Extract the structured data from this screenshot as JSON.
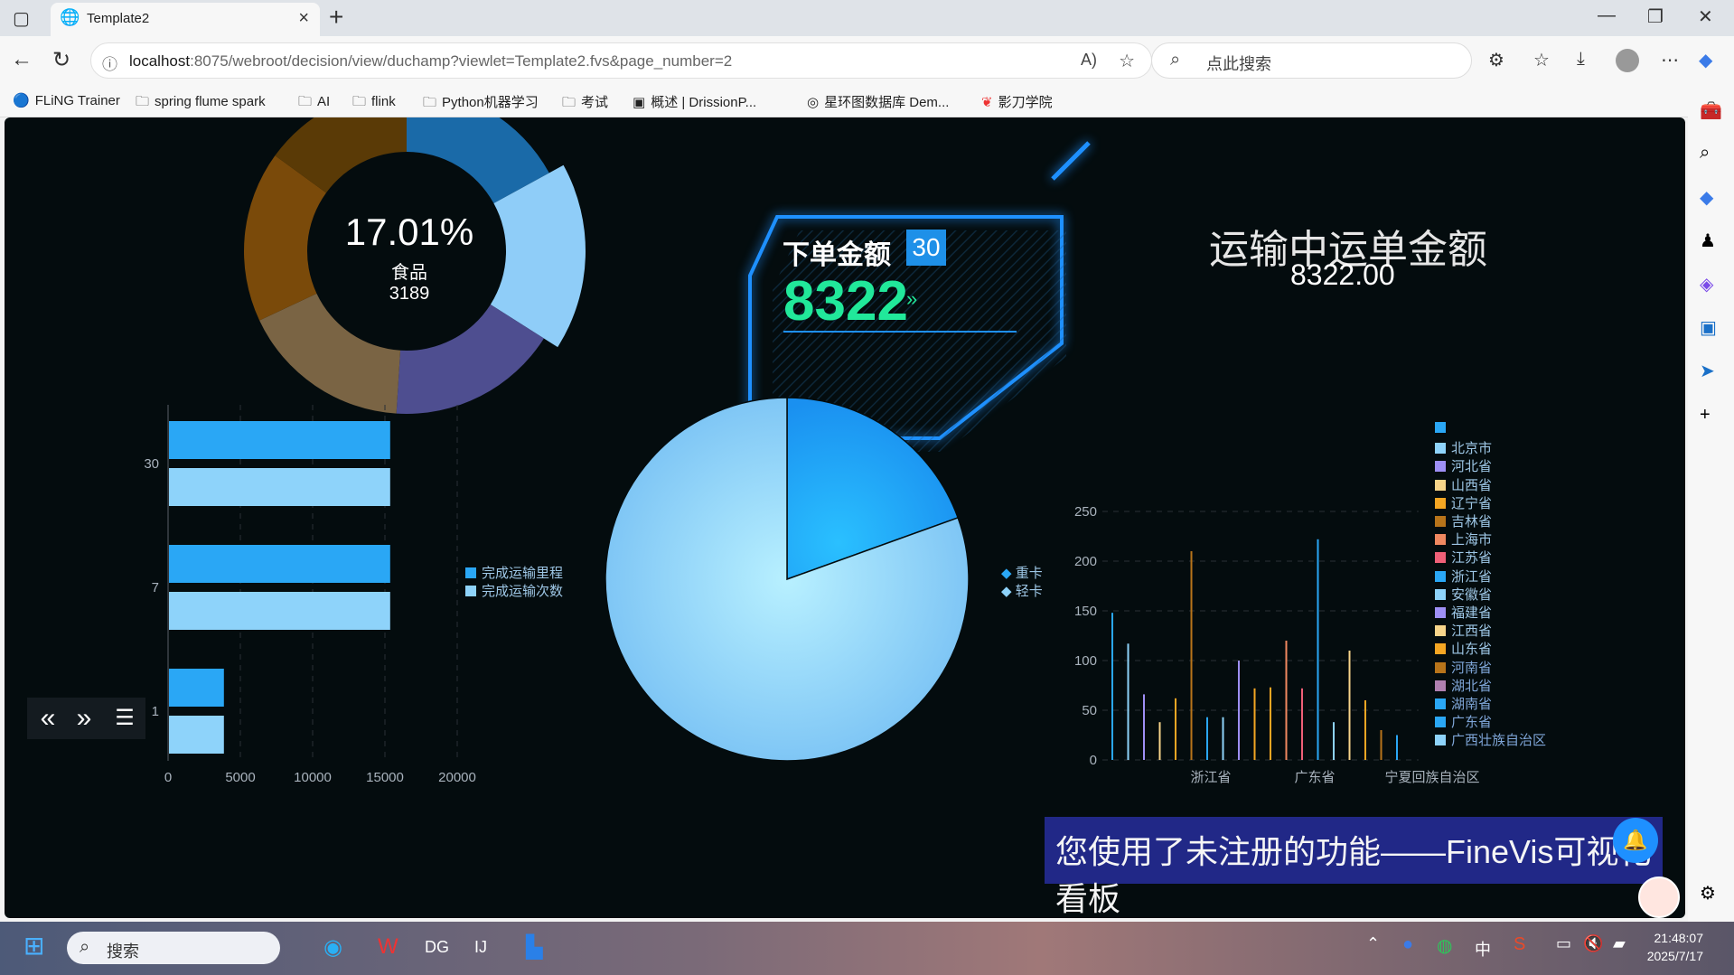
{
  "browser": {
    "tab_title": "Template2",
    "url_host": "localhost",
    "url_rest": ":8075/webroot/decision/view/duchamp?viewlet=Template2.fvs&page_number=2",
    "search_placeholder": "点此搜索",
    "bookmarks": [
      "FLiNG Trainer",
      "spring  flume  spark",
      "AI",
      "flink",
      "Python机器学习",
      "考试",
      "概述 | DrissionP...",
      "星环图数据库 Dem...",
      "影刀学院"
    ]
  },
  "donut": {
    "percent": "17.01%",
    "name": "食品",
    "value": "3189"
  },
  "order": {
    "title": "下单金额",
    "badge": "30",
    "value": "8322",
    "arrow": "»"
  },
  "transport": {
    "title": "运输中运单金额",
    "value": "8322.00"
  },
  "chart_data": [
    {
      "type": "pie",
      "title": "",
      "labels": [
        "",
        "",
        "",
        "",
        "",
        ""
      ],
      "values": [
        17.01,
        17.0,
        17.0,
        17.0,
        17.0,
        15.0
      ],
      "colors": [
        "#1a6aa8",
        "#8fcdf8",
        "#4e4e90",
        "#7a6444",
        "#7a4a0a",
        "#5a3a06"
      ]
    },
    {
      "type": "bar",
      "orientation": "horizontal",
      "categories": [
        "30",
        "7",
        "1"
      ],
      "series": [
        {
          "name": "完成运输里程",
          "values": [
            15300,
            15300,
            3800
          ],
          "color": "#2aa7f5"
        },
        {
          "name": "完成运输次数",
          "values": [
            15300,
            15300,
            3800
          ],
          "color": "#8ed3fa"
        }
      ],
      "xlim": [
        0,
        20000
      ],
      "xticks": [
        "0",
        "5000",
        "10000",
        "15000",
        "20000"
      ]
    },
    {
      "type": "pie",
      "labels": [
        "重卡",
        "轻卡"
      ],
      "values": [
        19.5,
        80.5
      ],
      "colors": [
        "#2aa7f5",
        "#8ed3fa"
      ]
    },
    {
      "type": "bar",
      "categories": [
        "浙江省",
        "广东省",
        "宁夏回族自治区"
      ],
      "ylim": [
        0,
        250
      ],
      "yticks": [
        "0",
        "50",
        "100",
        "150",
        "200",
        "250"
      ],
      "legend": [
        "",
        "北京市",
        "河北省",
        "山西省",
        "辽宁省",
        "吉林省",
        "上海市",
        "江苏省",
        "浙江省",
        "安徽省",
        "福建省",
        "江西省",
        "山东省",
        "河南省",
        "湖北省",
        "湖南省",
        "广东省",
        "广西壮族自治区"
      ],
      "legend_colors": [
        "#2aa7f5",
        "#8ed3fa",
        "#9e8ff5",
        "#f8d58a",
        "#f5a623",
        "#b8741a",
        "#f08860",
        "#f06078",
        "#2aa7f5",
        "#8ed3fa",
        "#9e8ff5",
        "#f8d58a",
        "#f5a623",
        "#b8741a",
        "#b080b0",
        "#2aa7f5",
        "#2aa7f5",
        "#8ed3fa"
      ],
      "values": [
        148,
        117,
        66,
        38,
        62,
        210,
        43,
        43,
        100,
        72,
        73,
        120,
        72,
        222,
        38,
        110,
        60,
        30,
        25
      ],
      "bar_colors": [
        "#2aa7f5",
        "#8ed3fa",
        "#9e8ff5",
        "#f8d58a",
        "#f5a623",
        "#b8741a",
        "#2aa7f5",
        "#8ed3fa",
        "#9e8ff5",
        "#f5a623",
        "#f5a623",
        "#f08860",
        "#f06078",
        "#2aa7f5",
        "#8ed3fa",
        "#f8d58a",
        "#f5a623",
        "#b8741a",
        "#2aa7f5"
      ]
    }
  ],
  "watermark": "您使用了未注册的功能——FineVis可视化看板",
  "taskbar": {
    "search": "搜索",
    "time": "21:48:07",
    "date": "2025/7/17",
    "ime": "中"
  }
}
